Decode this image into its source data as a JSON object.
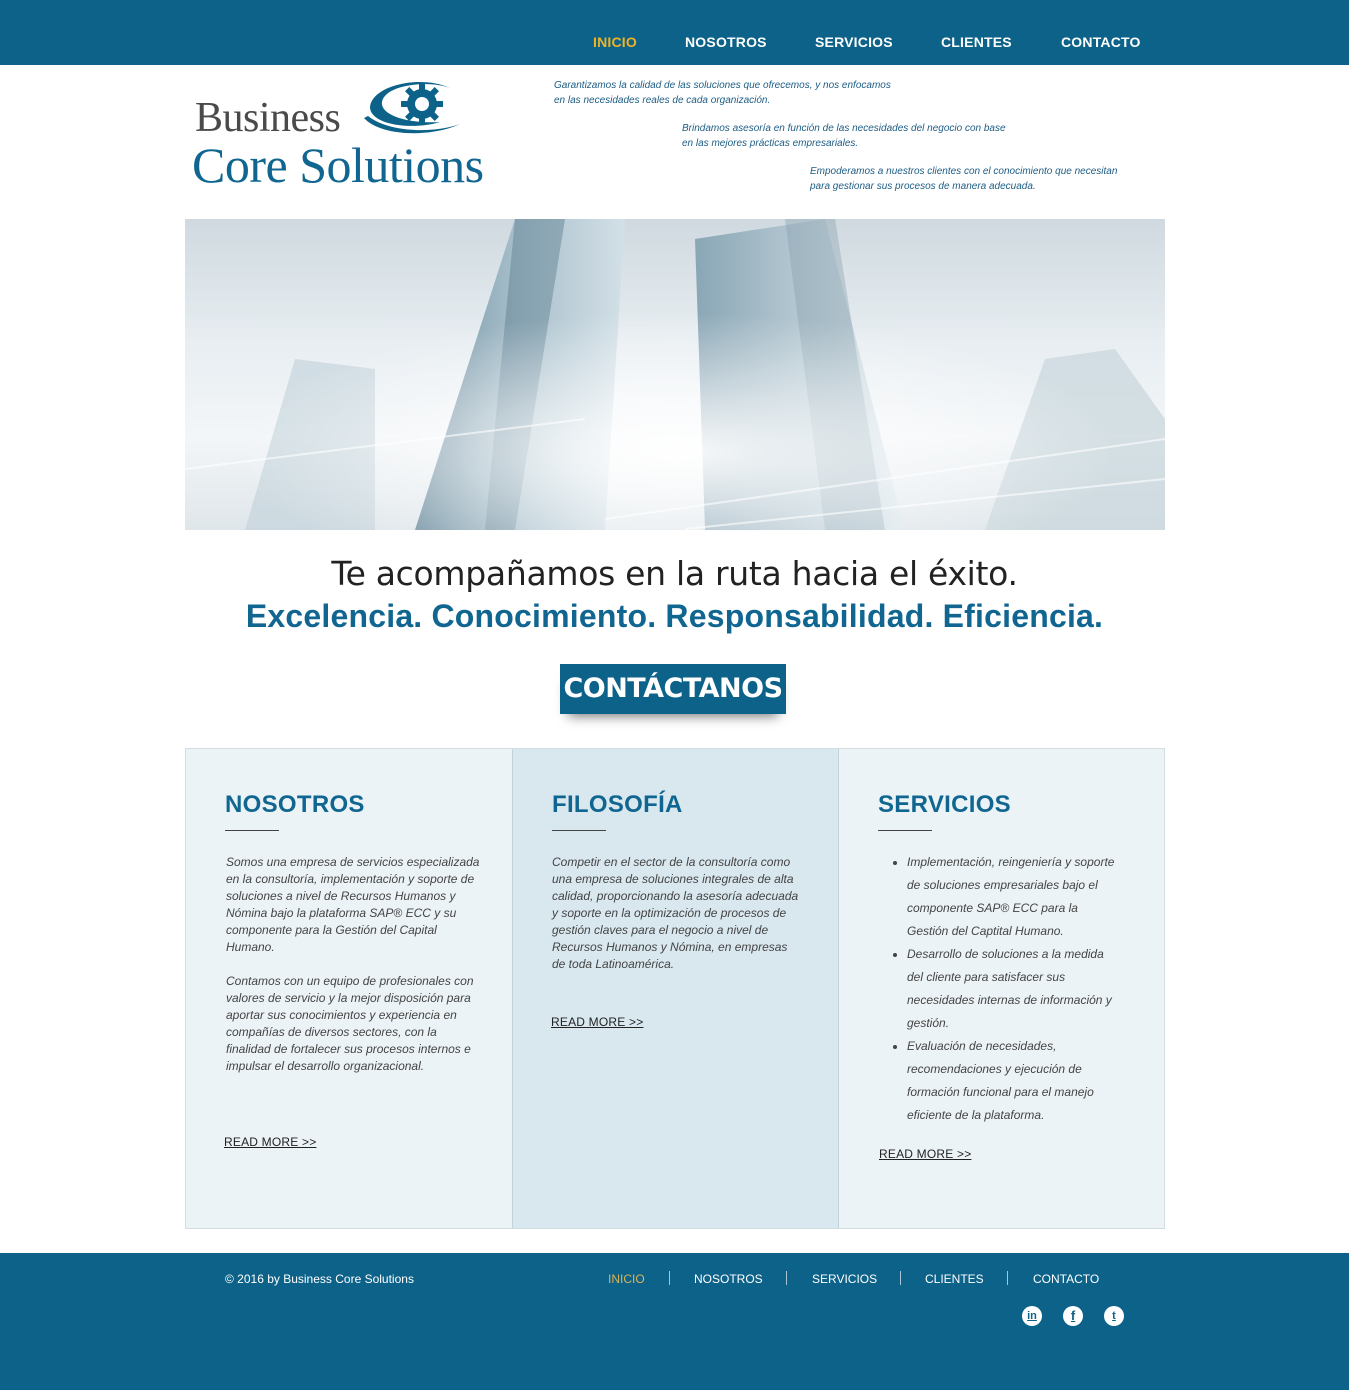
{
  "header": {
    "nav": [
      {
        "label": "INICIO",
        "active": true
      },
      {
        "label": "NOSOTROS",
        "active": false
      },
      {
        "label": "SERVICIOS",
        "active": false
      },
      {
        "label": "CLIENTES",
        "active": false
      },
      {
        "label": "CONTACTO",
        "active": false
      }
    ],
    "logo": {
      "line1": "Business",
      "line2": "Core Solutions",
      "icon": "gear-logo-icon"
    },
    "taglines": [
      {
        "line1": "Garantizamos la calidad de las soluciones que ofrecemos, y nos enfocamos",
        "line2": "en las necesidades reales de cada organización."
      },
      {
        "line1": "Brindamos asesoría en función de las necesidades del negocio con base",
        "line2": "en las mejores prácticas empresariales."
      },
      {
        "line1": "Empoderamos a nuestros clientes con el conocimiento que necesitan",
        "line2": "para gestionar sus procesos de manera adecuada."
      }
    ]
  },
  "hero": {
    "image": "skyscrapers-image"
  },
  "headline": {
    "line1": "Te acompañamos en la ruta hacia el éxito.",
    "line2": "Excelencia. Conocimiento. Responsabilidad. Eficiencia."
  },
  "cta": {
    "label": "CONTÁCTANOS"
  },
  "columns": {
    "nosotros": {
      "title": "NOSOTROS",
      "para1": "Somos una empresa de servicios especializada en la consultoría, implementación y soporte de soluciones a nivel de Recursos Humanos y Nómina bajo la plataforma SAP® ECC y su componente para la Gestión del Capital Humano.",
      "para2": "Contamos con un equipo de profesionales con valores de servicio y la mejor disposición para aportar sus conocimientos y experiencia en compañías de diversos sectores, con la finalidad de fortalecer sus procesos internos e impulsar el desarrollo organizacional.",
      "more": "READ MORE >>"
    },
    "filosofia": {
      "title": "FILOSOFÍA",
      "para1": "Competir en el sector de la consultoría como una empresa de soluciones integrales de alta calidad, proporcionando la asesoría adecuada y soporte en la optimización de procesos de gestión claves para el negocio a nivel de Recursos Humanos y Nómina, en empresas de toda Latinoamérica.",
      "more": "READ MORE >>"
    },
    "servicios": {
      "title": "SERVICIOS",
      "items": [
        "Implementación, reingeniería y soporte de soluciones empresariales bajo el componente SAP® ECC para la Gestión del Captital Humano.",
        "Desarrollo de soluciones a la medida del cliente para satisfacer sus necesidades internas de información y gestión.",
        "Evaluación de necesidades, recomendaciones y ejecución de formación funcional para el manejo eficiente de la plataforma."
      ],
      "more": "READ MORE >>"
    }
  },
  "footer": {
    "copyright": "© 2016 by Business Core Solutions",
    "nav": [
      {
        "label": "INICIO",
        "active": true
      },
      {
        "label": "NOSOTROS",
        "active": false
      },
      {
        "label": "SERVICIOS",
        "active": false
      },
      {
        "label": "CLIENTES",
        "active": false
      },
      {
        "label": "CONTACTO",
        "active": false
      }
    ],
    "social": [
      {
        "icon": "linkedin-icon",
        "glyph": "in"
      },
      {
        "icon": "facebook-icon",
        "glyph": "f"
      },
      {
        "icon": "twitter-icon",
        "glyph": "t"
      }
    ]
  },
  "colors": {
    "brand": "#0d6289",
    "active_nav": "#f0b323",
    "title": "#106690"
  }
}
